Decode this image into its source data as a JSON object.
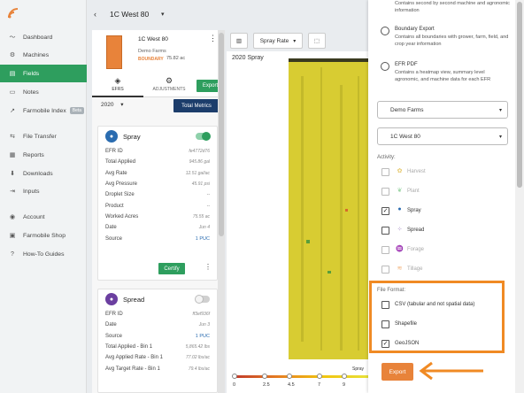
{
  "nav": {
    "items": [
      {
        "label": "Dashboard",
        "icon": "pulse-icon"
      },
      {
        "label": "Machines",
        "icon": "tractor-icon"
      },
      {
        "label": "Fields",
        "icon": "map-icon"
      },
      {
        "label": "Notes",
        "icon": "note-icon"
      },
      {
        "label": "Farmobile Index",
        "icon": "index-icon",
        "badge": "Beta"
      },
      {
        "label": "File Transfer",
        "icon": "transfer-icon"
      },
      {
        "label": "Reports",
        "icon": "reports-icon"
      },
      {
        "label": "Downloads",
        "icon": "download-icon"
      },
      {
        "label": "Inputs",
        "icon": "inputs-icon"
      },
      {
        "label": "Account",
        "icon": "account-icon"
      },
      {
        "label": "Farmobile Shop",
        "icon": "cart-icon"
      },
      {
        "label": "How-To Guides",
        "icon": "help-icon"
      }
    ],
    "active": "Fields"
  },
  "topbar": {
    "back": "‹",
    "title": "1C West 80",
    "caret": "▾"
  },
  "field": {
    "name": "1C West 80",
    "farm": "Demo Farms",
    "boundary": "BOUNDARY",
    "acres": "75.82 ac",
    "tabs": [
      "EFRS",
      "ADJUSTMENTS"
    ],
    "export_label": "Export",
    "year": "2020",
    "year_caret": "▾",
    "total_metrics": "Total Metrics"
  },
  "spray_card": {
    "title": "Spray",
    "rows": [
      {
        "label": "EFR ID",
        "value": "fe4772d76"
      },
      {
        "label": "Total Applied",
        "value": "945.86 gal"
      },
      {
        "label": "Avg Rate",
        "value": "12.51 gal/ac"
      },
      {
        "label": "Avg Pressure",
        "value": "45.91 psi"
      },
      {
        "label": "Droplet Size",
        "value": "--"
      },
      {
        "label": "Product",
        "value": "--"
      },
      {
        "label": "Worked Acres",
        "value": "75.55 ac"
      },
      {
        "label": "Date",
        "value": "Jun 4"
      },
      {
        "label": "Source",
        "value": "1 PUC"
      }
    ],
    "certify": "Certify"
  },
  "spread_card": {
    "title": "Spread",
    "rows": [
      {
        "label": "EFR ID",
        "value": "ff3ef936f"
      },
      {
        "label": "Date",
        "value": "Jun 3"
      },
      {
        "label": "Source",
        "value": "1 PUC"
      },
      {
        "label": "Total Applied - Bin 1",
        "value": "5,865.42 lbs"
      },
      {
        "label": "Avg Applied Rate - Bin 1",
        "value": "77.02 lbs/ac"
      },
      {
        "label": "Avg Target Rate - Bin 1",
        "value": "79.4 lbs/ac"
      }
    ]
  },
  "map": {
    "label": "2020 Spray",
    "layer_select": "Spray Rate",
    "legend_values": [
      "0",
      "2.5",
      "4.5",
      "7",
      "9"
    ],
    "legend_tag": "Spray"
  },
  "export_panel": {
    "options": [
      {
        "title": "",
        "desc": "Contains second by second machine and agronomic information"
      },
      {
        "title": "Boundary Export",
        "desc": "Contains all boundaries with grower, farm, field, and crop year information"
      },
      {
        "title": "EFR PDF",
        "desc": "Contains a heatmap view, summary level agronomic, and machine data for each EFR"
      }
    ],
    "farm_select": "Demo Farms",
    "field_select": "1C West 80",
    "activity_label": "Activity:",
    "activities": [
      {
        "label": "Harvest",
        "checked": false,
        "enabled": false,
        "icon": "harvest-icon"
      },
      {
        "label": "Plant",
        "checked": false,
        "enabled": false,
        "icon": "plant-icon"
      },
      {
        "label": "Spray",
        "checked": true,
        "enabled": true,
        "icon": "drop-icon"
      },
      {
        "label": "Spread",
        "checked": false,
        "enabled": true,
        "icon": "spread-icon"
      },
      {
        "label": "Forage",
        "checked": false,
        "enabled": false,
        "icon": "forage-icon"
      },
      {
        "label": "Tillage",
        "checked": false,
        "enabled": false,
        "icon": "tillage-icon"
      }
    ],
    "file_format_label": "File Format:",
    "formats": [
      {
        "label": "CSV (tabular and not spatial data)",
        "checked": false
      },
      {
        "label": "Shapefile",
        "checked": false
      },
      {
        "label": "GeoJSON",
        "checked": true
      }
    ],
    "export_button": "Export",
    "check_mark": "✓",
    "accent": "#f08a24"
  }
}
